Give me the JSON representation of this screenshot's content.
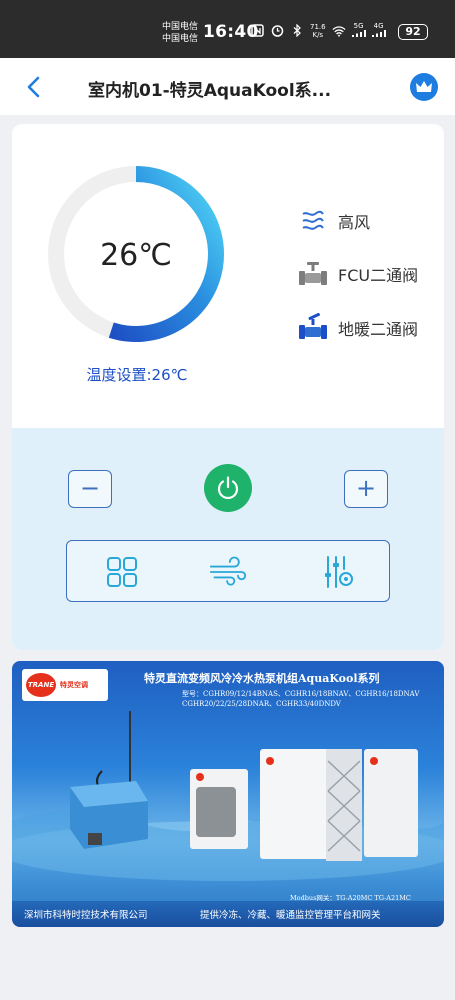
{
  "status_bar": {
    "carrier1": "中国电信",
    "carrier2": "中国电信",
    "time": "16:40",
    "speed_value": "71.6",
    "speed_unit": "K/s",
    "net1": "5G",
    "net2": "4G",
    "battery": "92"
  },
  "header": {
    "title": "室内机01-特灵AquaKool系..."
  },
  "gauge": {
    "temperature": "26℃",
    "level": 0.55,
    "setpoint_label": "温度设置:26℃"
  },
  "status_items": [
    {
      "label": "高风",
      "icon": "wind-icon"
    },
    {
      "label": "FCU二通阀",
      "icon": "valve-icon"
    },
    {
      "label": "地暖二通阀",
      "icon": "valve-active-icon"
    }
  ],
  "controls": {
    "minus": "−",
    "plus": "+"
  },
  "banner": {
    "brand": "TRANE",
    "brand_sub": "特灵空调",
    "title": "特灵直流变频风冷冷水热泵机组AquaKool系列",
    "models_line1": "型号：CGHR09/12/14BNAS、CGHR16/18BNAV、CGHR16/18DNAV",
    "models_line2": "CGHR20/22/25/28DNAR、CGHR33/40DNDV",
    "gateway": "Modbus网关：TG-A20MC TG-A21MC",
    "company": "深圳市科特时控技术有限公司",
    "slogan": "提供冷冻、冷藏、暖通监控管理平台和网关"
  },
  "colors": {
    "accent": "#1c4fc7",
    "power": "#1fb26b",
    "gauge_start": "#1e4fc4",
    "gauge_end": "#4fd6f5"
  }
}
